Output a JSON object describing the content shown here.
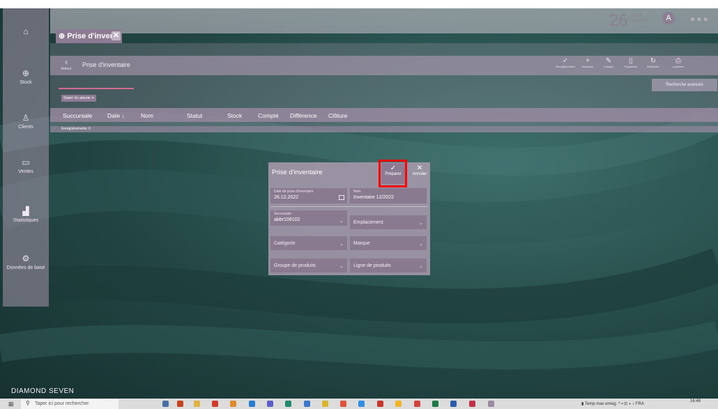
{
  "header": {
    "day_number": "26",
    "day_text_line1": "Lundi",
    "day_text_line2": "16:48:44",
    "avatar_letter": "A"
  },
  "tab": {
    "label": "Prise d'invent",
    "close": "✕"
  },
  "sidebar": {
    "items": [
      {
        "label": ""
      },
      {
        "label": "Stock"
      },
      {
        "label": "Clients"
      },
      {
        "label": "Ventes"
      },
      {
        "label": "Statistiques"
      },
      {
        "label": "Données de base"
      }
    ]
  },
  "toolbar": {
    "back_label": "Retour",
    "title": "Prise d'inventaire",
    "buttons": [
      "Enregistrement",
      "Nouveau",
      "Corriger",
      "Supprimer",
      "Rafraîchir",
      "Imprimer"
    ]
  },
  "search": {
    "advanced_label": "Recherche avancée"
  },
  "filter_chip": "Statut: En attente ✕",
  "columns": [
    "Succursale",
    "Date ↓",
    "Nom",
    "Statut",
    "Stock",
    "Compté",
    "Différence",
    "Clôture"
  ],
  "records": "Enregistrements: 0",
  "dialog": {
    "title": "Prise d'inventaire",
    "prepare_label": "Préparer",
    "cancel_label": "Annuler",
    "date_label": "Date de prise d'inventaire",
    "date_value": "26.12.2022",
    "name_label": "Nom",
    "name_value": "Inventaire 12/2022",
    "branch_label": "Succursale",
    "branch_value": "abbr108102",
    "location_placeholder": "Emplacement",
    "category_placeholder": "Catégorie",
    "brand_placeholder": "Marque",
    "product_group_placeholder": "Groupe de produits",
    "product_line_placeholder": "Ligne de produits"
  },
  "brand": "DIAMOND SEVEN",
  "taskbar": {
    "search_placeholder": "Taper ici pour rechercher",
    "tray_text": "Temp max enreg.",
    "lang": "FRA",
    "time": "16:48"
  }
}
